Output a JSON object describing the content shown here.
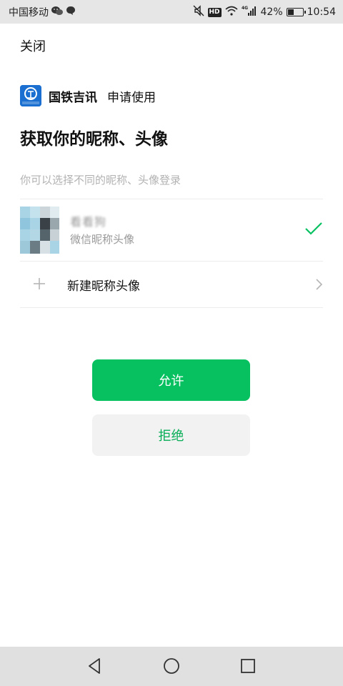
{
  "status_bar": {
    "carrier": "中国移动",
    "network": "4G",
    "battery": "42%",
    "battery_level": 0.42,
    "time": "10:54",
    "icons": [
      "wechat-icon",
      "message-icon",
      "mute-icon",
      "hd-icon",
      "wifi-icon",
      "signal-icon",
      "battery-icon"
    ]
  },
  "header": {
    "close_label": "关闭"
  },
  "app": {
    "name": "国铁吉讯",
    "request_text": "申请使用",
    "logo_icon": "railway-logo-icon",
    "brand_color": "#1a6fd1"
  },
  "main": {
    "title": "获取你的昵称、头像",
    "subtitle": "你可以选择不同的昵称、头像登录",
    "profile": {
      "name": "看看狗",
      "sub_label": "微信昵称头像",
      "selected": true
    },
    "new_profile": {
      "label": "新建昵称头像"
    }
  },
  "actions": {
    "allow_label": "允许",
    "deny_label": "拒绝",
    "accent_color": "#07c160"
  },
  "nav": {
    "icons": [
      "back-icon",
      "home-icon",
      "recents-icon"
    ]
  }
}
